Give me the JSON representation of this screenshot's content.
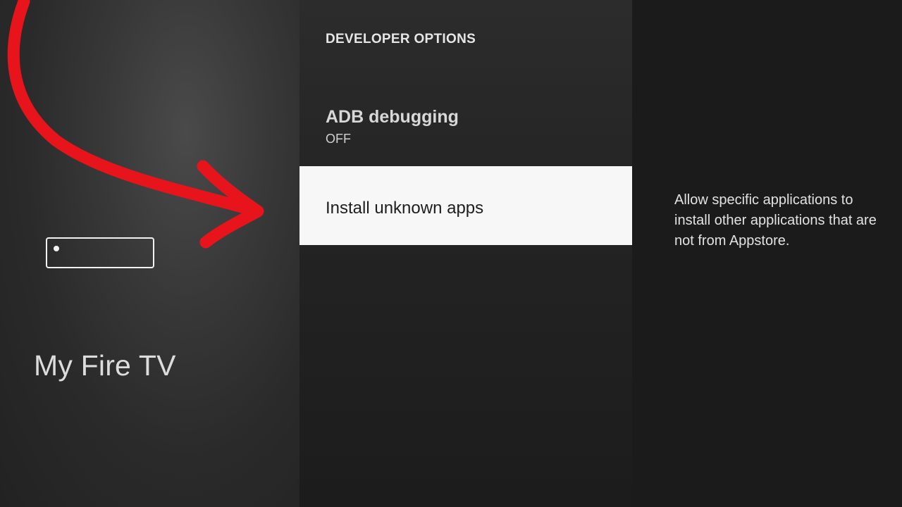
{
  "sidebar": {
    "section_title": "My Fire TV",
    "icon": "fire-tv-stick-icon"
  },
  "main": {
    "heading": "DEVELOPER OPTIONS",
    "items": [
      {
        "label": "ADB debugging",
        "value": "OFF"
      },
      {
        "label": "Install unknown apps"
      }
    ]
  },
  "details": {
    "description": "Allow specific applications to install other applications that are not from Appstore."
  },
  "overlay": {
    "annotation": "red-arrow",
    "color": "#e8141c"
  },
  "colors": {
    "focus_background": "#f7f7f7",
    "background": "#1b1b1b"
  }
}
